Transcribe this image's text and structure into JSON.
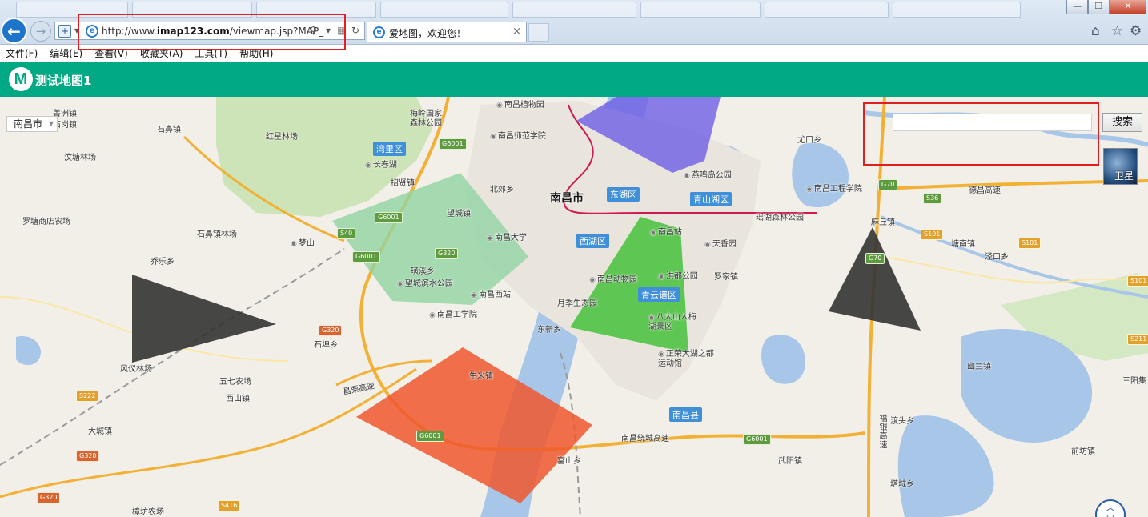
{
  "browser": {
    "url": "http://www.imap123.com/viewmap.jsp?MAP_",
    "url_prefix": "http://www.",
    "url_domain": "imap123.com",
    "url_rest": "/viewmap.jsp?MAP_",
    "tab_title": "爱地图，欢迎您！",
    "tab_close": "×",
    "win_min": "—",
    "win_max": "❐",
    "win_close": "✕",
    "back_icon": "←",
    "fwd_icon": "→",
    "ie_icon": "e",
    "tools": {
      "home": "⌂",
      "favorites": "☆",
      "settings": "⚙"
    }
  },
  "menu": [
    "文件(F)",
    "编辑(E)",
    "查看(V)",
    "收藏夹(A)",
    "工具(T)",
    "帮助(H)"
  ],
  "app": {
    "logo": "M",
    "title": "测试地图1"
  },
  "controls": {
    "city": "南昌市",
    "search_placeholder": "",
    "search_button": "搜索",
    "satellite": "卫星",
    "nav": "︿\n〈 〉"
  },
  "map": {
    "city_label": "南昌市",
    "districts": [
      "湾里区",
      "东湖区",
      "青山湖区",
      "西湖区",
      "青云谱区",
      "南昌县"
    ],
    "places": [
      "菁洲镇",
      "石岗镇",
      "石鼻镇",
      "汶塘林场",
      "红星林场",
      "梅岭国家森林公园",
      "长春湖",
      "招贤镇",
      "南昌植物园",
      "南昌师范学院",
      "北郊乡",
      "燕鸣岛公园",
      "尤口乡",
      "南昌工程学院",
      "德昌高速",
      "罗塘商店农场",
      "石鼻镇林场",
      "梦山",
      "望城镇",
      "南昌大学",
      "瑶湖森林公园",
      "麻丘镇",
      "塘南镇",
      "泾口乡",
      "乔乐乡",
      "璜溪乡",
      "望城滨水公园",
      "南昌西站",
      "南昌站",
      "天香园",
      "南昌动物园",
      "洪都公园",
      "罗家镇",
      "南昌工学院",
      "月季生态园",
      "八大山人梅湖景区",
      "东新乡",
      "石埠乡",
      "风仪林场",
      "正荣大湖之都运动馆",
      "幽兰镇",
      "三阳集",
      "五七农场",
      "生米镇",
      "西山镇",
      "昌栗高速",
      "大城镇",
      "渡头乡",
      "南昌绕城高速",
      "前坊镇",
      "武阳镇",
      "富山乡",
      "塔城乡",
      "樟坊农场",
      "福银高速"
    ],
    "road_shields": [
      {
        "text": "G6001",
        "kind": "g"
      },
      {
        "text": "G6001",
        "kind": "g"
      },
      {
        "text": "G6001",
        "kind": "g"
      },
      {
        "text": "G6001",
        "kind": "g"
      },
      {
        "text": "G6001",
        "kind": "g"
      },
      {
        "text": "S40",
        "kind": "g"
      },
      {
        "text": "G320",
        "kind": "g"
      },
      {
        "text": "G320",
        "kind": "r"
      },
      {
        "text": "G320",
        "kind": "r"
      },
      {
        "text": "G320",
        "kind": "r"
      },
      {
        "text": "S222",
        "kind": "o"
      },
      {
        "text": "S416",
        "kind": "o"
      },
      {
        "text": "G70",
        "kind": "g"
      },
      {
        "text": "G70",
        "kind": "g"
      },
      {
        "text": "S36",
        "kind": "g"
      },
      {
        "text": "S101",
        "kind": "o"
      },
      {
        "text": "S101",
        "kind": "o"
      },
      {
        "text": "S101",
        "kind": "o"
      },
      {
        "text": "S211",
        "kind": "o"
      }
    ]
  },
  "overlays": {
    "colors": {
      "purple": "#6b5be6",
      "green_light": "#8fd3a2",
      "green": "#45c13a",
      "red": "#f0572e",
      "black": "#333333"
    }
  }
}
